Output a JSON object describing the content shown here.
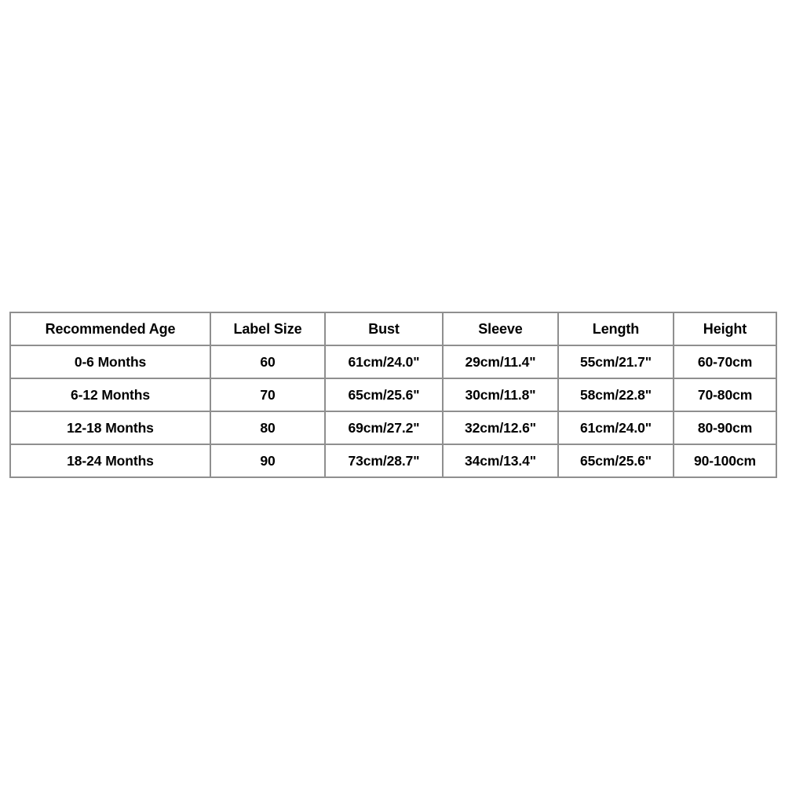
{
  "page": {
    "background_color": "#ffffff",
    "border_color": "#8f8f8f",
    "text_color": "#000000"
  },
  "chart_data": {
    "type": "table",
    "title": "",
    "columns": [
      "Recommended Age",
      "Label Size",
      "Bust",
      "Sleeve",
      "Length",
      "Height"
    ],
    "rows": [
      [
        "0-6 Months",
        "60",
        "61cm/24.0\"",
        "29cm/11.4\"",
        "55cm/21.7\"",
        "60-70cm"
      ],
      [
        "6-12 Months",
        "70",
        "65cm/25.6\"",
        "30cm/11.8\"",
        "58cm/22.8\"",
        "70-80cm"
      ],
      [
        "12-18 Months",
        "80",
        "69cm/27.2\"",
        "32cm/12.6\"",
        "61cm/24.0\"",
        "80-90cm"
      ],
      [
        "18-24 Months",
        "90",
        "73cm/28.7\"",
        "34cm/13.4\"",
        "65cm/25.6\"",
        "90-100cm"
      ]
    ]
  },
  "size_chart": {
    "headers": {
      "age": "Recommended Age",
      "label_size": "Label Size",
      "bust": "Bust",
      "sleeve": "Sleeve",
      "length": "Length",
      "height": "Height"
    },
    "rows": [
      {
        "age": "0-6 Months",
        "label_size": "60",
        "bust": "61cm/24.0\"",
        "sleeve": "29cm/11.4\"",
        "length": "55cm/21.7\"",
        "height": "60-70cm"
      },
      {
        "age": "6-12 Months",
        "label_size": "70",
        "bust": "65cm/25.6\"",
        "sleeve": "30cm/11.8\"",
        "length": "58cm/22.8\"",
        "height": "70-80cm"
      },
      {
        "age": "12-18 Months",
        "label_size": "80",
        "bust": "69cm/27.2\"",
        "sleeve": "32cm/12.6\"",
        "length": "61cm/24.0\"",
        "height": "80-90cm"
      },
      {
        "age": "18-24 Months",
        "label_size": "90",
        "bust": "73cm/28.7\"",
        "sleeve": "34cm/13.4\"",
        "length": "65cm/25.6\"",
        "height": "90-100cm"
      }
    ]
  }
}
